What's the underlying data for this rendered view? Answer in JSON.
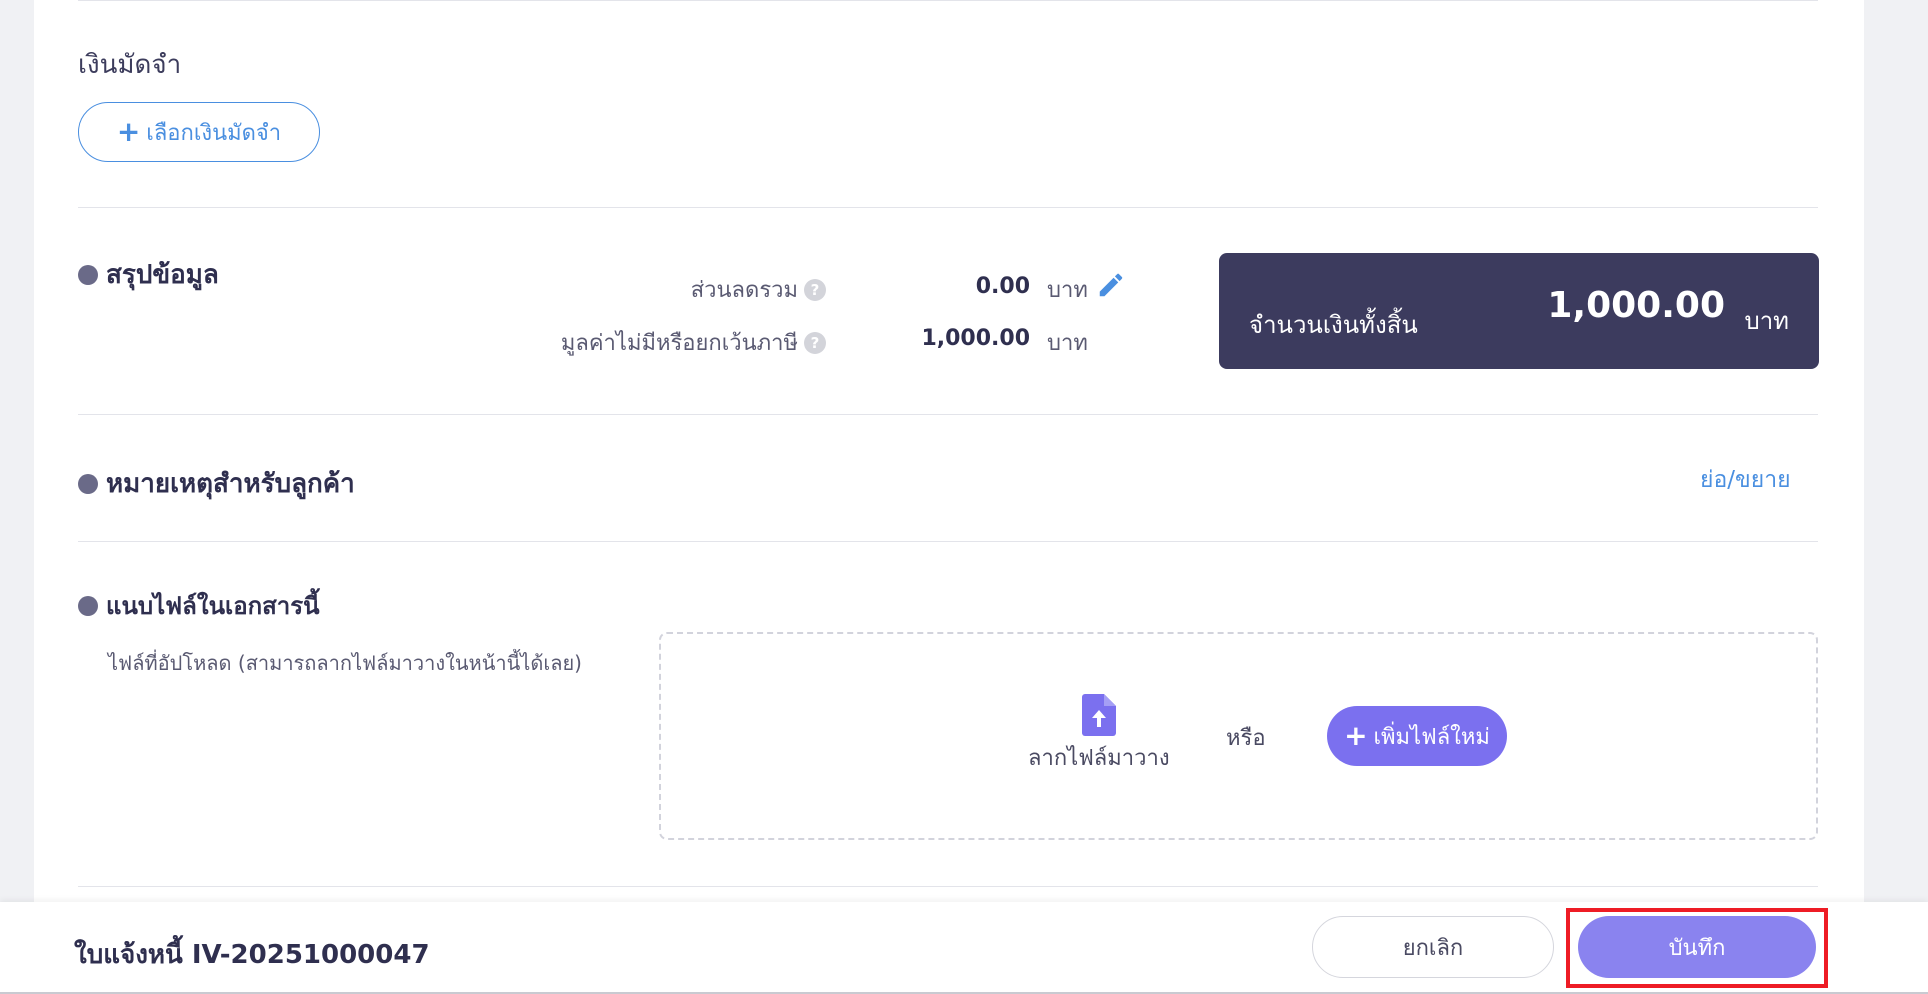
{
  "deposit": {
    "title": "เงินมัดจำ",
    "select_label": "เลือกเงินมัดจำ"
  },
  "summary": {
    "title": "สรุปข้อมูล",
    "discount_label": "ส่วนลดรวม",
    "discount_value": "0.00",
    "exempt_label": "มูลค่าไม่มีหรือยกเว้นภาษี",
    "exempt_value": "1,000.00",
    "unit": "บาท",
    "total_label": "จำนวนเงินทั้งสิ้น",
    "total_value": "1,000.00",
    "total_unit": "บาท"
  },
  "notes": {
    "title": "หมายเหตุสำหรับลูกค้า",
    "toggle_label": "ย่อ/ขยาย"
  },
  "attachments": {
    "title": "แนบไฟล์ในเอกสารนี้",
    "hint": "ไฟล์ที่อัปโหลด (สามารถลากไฟล์มาวางในหน้านี้ได้เลย)",
    "drop_label": "ลากไฟล์มาวาง",
    "or_label": "หรือ",
    "add_label": "เพิ่มไฟล์ใหม่"
  },
  "footer": {
    "doc_title": "ใบแจ้งหนี้ IV-20251000047",
    "cancel_label": "ยกเลิก",
    "save_label": "บันทึก"
  },
  "colors": {
    "accent_blue": "#4a8fe0",
    "purple": "#7b70ef",
    "dark_total": "#3c3b5e",
    "highlight": "#ee1c25"
  }
}
